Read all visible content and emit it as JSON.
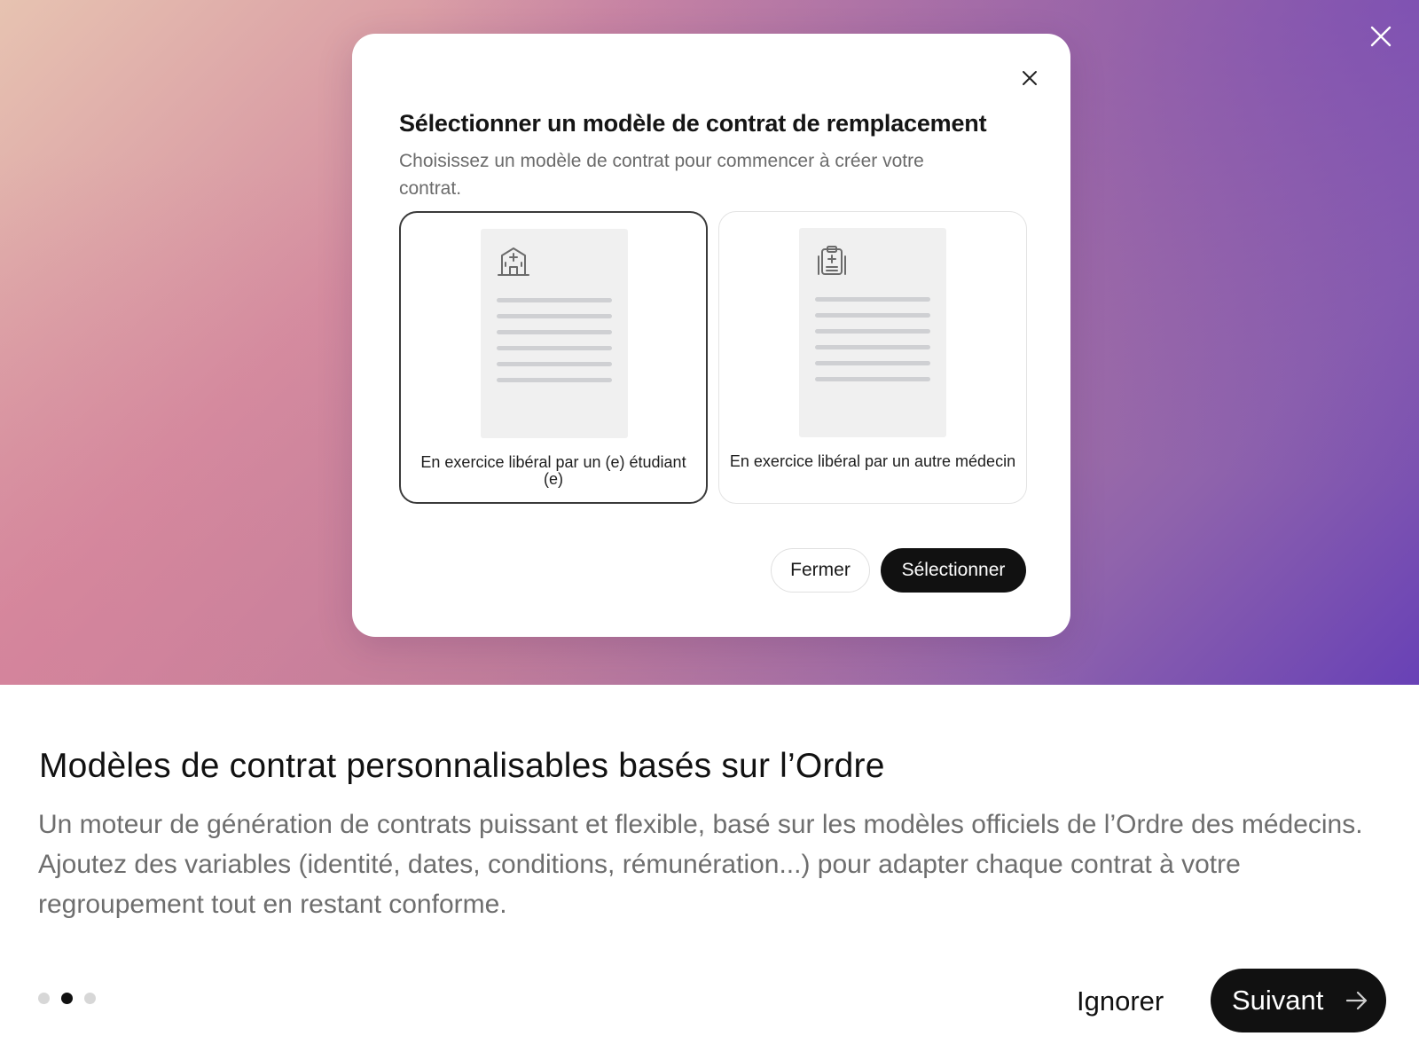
{
  "modal": {
    "title": "Sélectionner un modèle de contrat de remplacement",
    "description": "Choisissez un modèle de contrat pour commencer à créer votre contrat.",
    "templates": [
      {
        "label": "En exercice libéral par un (e) étudiant (e)",
        "icon": "hospital-icon",
        "selected": true
      },
      {
        "label": "En exercice libéral par un autre médecin",
        "icon": "medical-clipboard-icon",
        "selected": false
      }
    ],
    "close_label": "Fermer",
    "select_label": "Sélectionner"
  },
  "feature": {
    "title": "Modèles de contrat personnalisables basés sur l’Ordre",
    "description": "Un moteur de génération de contrats puissant et flexible, basé sur les modèles officiels de l’Ordre des médecins. Ajoutez des variables (identité, dates, conditions, rémunération...) pour adapter chaque contrat à votre regroupement tout en restant conforme."
  },
  "pagination": {
    "total": 3,
    "current": 2
  },
  "footer": {
    "ignore_label": "Ignorer",
    "next_label": "Suivant"
  },
  "colors": {
    "primary": "#111111",
    "gradient_start": "#e7c3b1",
    "gradient_end": "#6841b6"
  }
}
